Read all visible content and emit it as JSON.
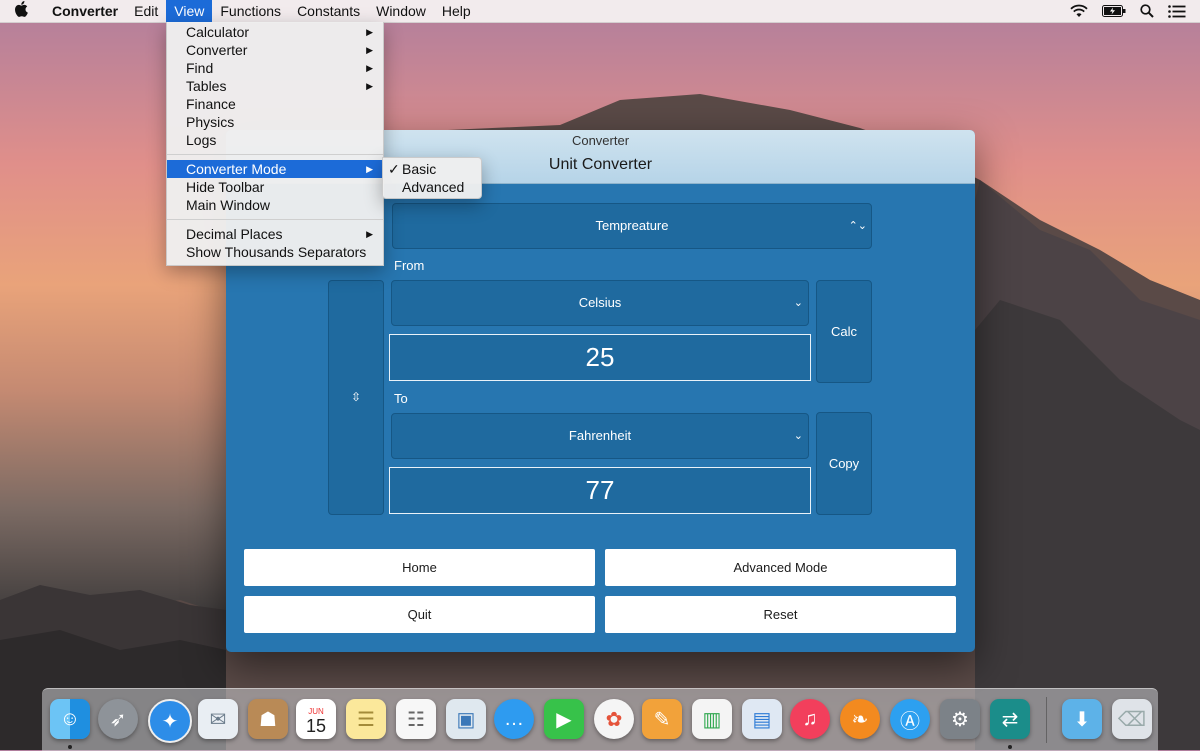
{
  "menubar": {
    "app": "Converter",
    "items": [
      "Edit",
      "View",
      "Functions",
      "Constants",
      "Window",
      "Help"
    ]
  },
  "view_menu": {
    "group1": [
      "Calculator",
      "Converter",
      "Find",
      "Tables",
      "Finance",
      "Physics",
      "Logs"
    ],
    "group2": [
      "Converter Mode",
      "Hide Toolbar",
      "Main Window"
    ],
    "group3": [
      "Decimal Places",
      "Show Thousands Separators"
    ]
  },
  "submenu": {
    "basic": "Basic",
    "advanced": "Advanced",
    "checked": "Basic",
    "checkmark": "✓"
  },
  "window": {
    "title": "Converter",
    "heading": "Unit Converter",
    "category": "Tempreature",
    "from_label": "From",
    "to_label": "To",
    "from_unit": "Celsius",
    "from_value": "25",
    "to_unit": "Fahrenheit",
    "to_value": "77",
    "swap_glyph": "⇳",
    "calc": "Calc",
    "copy": "Copy",
    "buttons": {
      "home": "Home",
      "advanced": "Advanced Mode",
      "quit": "Quit",
      "reset": "Reset"
    }
  },
  "dock": {
    "calendar_month": "JUN",
    "calendar_day": "15",
    "icons": [
      "finder-icon",
      "launchpad-icon",
      "safari-icon",
      "mail-icon",
      "contacts-icon",
      "calendar-icon",
      "notes-icon",
      "reminders-icon",
      "preview-icon",
      "messages-icon",
      "facetime-icon",
      "photos-icon",
      "pages-icon",
      "numbers-icon",
      "keynote-icon",
      "itunes-icon",
      "ibooks-icon",
      "app-store-icon",
      "system-preferences-icon",
      "converter-app-icon",
      "downloads-icon",
      "trash-icon"
    ]
  }
}
